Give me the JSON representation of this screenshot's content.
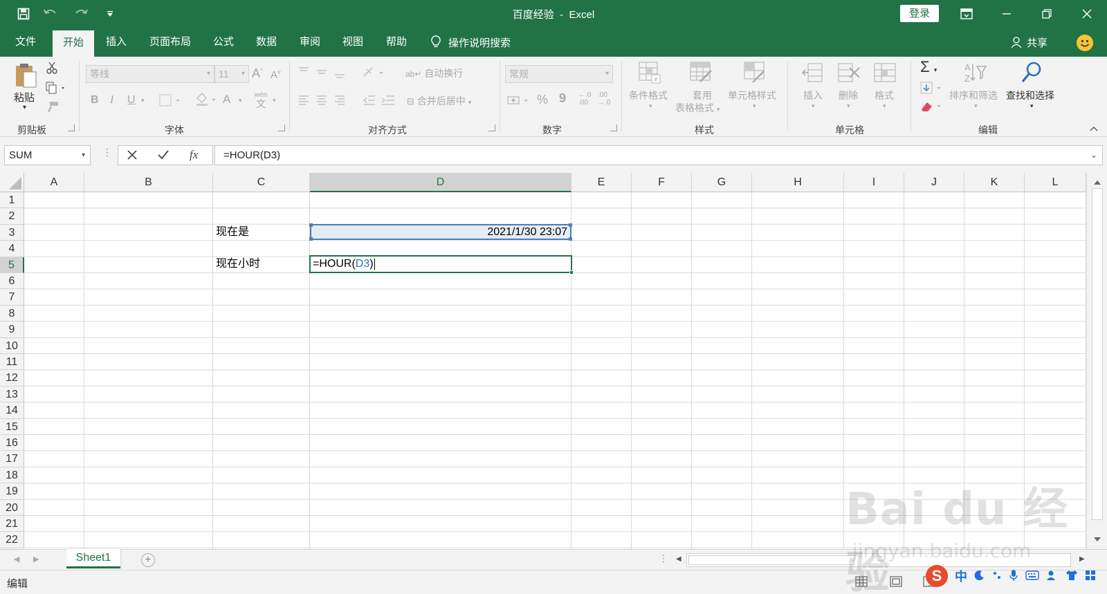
{
  "window": {
    "title_doc": "百度经验",
    "title_sep": "-",
    "title_app": "Excel",
    "login_label": "登录"
  },
  "tabs": [
    "文件",
    "开始",
    "插入",
    "页面布局",
    "公式",
    "数据",
    "审阅",
    "视图",
    "帮助"
  ],
  "active_tab": "开始",
  "tell_me": "操作说明搜索",
  "share_label": "共享",
  "ribbon": {
    "clipboard": {
      "paste": "粘贴",
      "group": "剪贴板"
    },
    "font": {
      "name": "等线",
      "size": "11",
      "bold": "B",
      "italic": "I",
      "underline": "U",
      "wen": "wén",
      "wen_char": "文",
      "grow": "A",
      "shrink": "A",
      "color": "A",
      "group": "字体"
    },
    "align": {
      "wrap": "自动换行",
      "merge": "合并后居中",
      "group": "对齐方式"
    },
    "number": {
      "format": "常规",
      "percent": "%",
      "comma": "9",
      "inc": "←.0",
      "inc2": ".00",
      "dec": ".00",
      "dec2": "→.0",
      "group": "数字"
    },
    "styles": {
      "cond": "条件格式",
      "table1": "套用",
      "table2": "表格格式",
      "cell": "单元格样式",
      "group": "样式"
    },
    "cells": {
      "insert": "插入",
      "delete": "删除",
      "format": "格式",
      "group": "单元格"
    },
    "edit": {
      "sum": "Σ",
      "sort": "排序和筛选",
      "find": "查找和选择",
      "group": "编辑"
    }
  },
  "formula_bar": {
    "name_box": "SUM",
    "fx": "fx",
    "formula": "=HOUR(D3)"
  },
  "columns": [
    "A",
    "B",
    "C",
    "D",
    "E",
    "F",
    "G",
    "H",
    "I",
    "J",
    "K",
    "L"
  ],
  "rows": [
    "1",
    "2",
    "3",
    "4",
    "5",
    "6",
    "7",
    "8",
    "9",
    "10",
    "11",
    "12",
    "13",
    "14",
    "15",
    "16",
    "17",
    "18",
    "19",
    "20",
    "21",
    "22"
  ],
  "cells": {
    "C3": "现在是",
    "D3": "2021/1/30 23:07",
    "C5": "现在小时",
    "D5_prefix": "=HOUR(",
    "D5_ref": "D3",
    "D5_suffix": ")"
  },
  "sheet": {
    "name": "Sheet1",
    "add": "+"
  },
  "status": {
    "mode": "编辑"
  },
  "ime": {
    "lang": "中"
  },
  "watermark": {
    "logo": "Bai du 经验",
    "url": "jingyan.baidu.com"
  },
  "colors": {
    "excel_green": "#217346",
    "ref_blue": "#2e6fbf"
  }
}
